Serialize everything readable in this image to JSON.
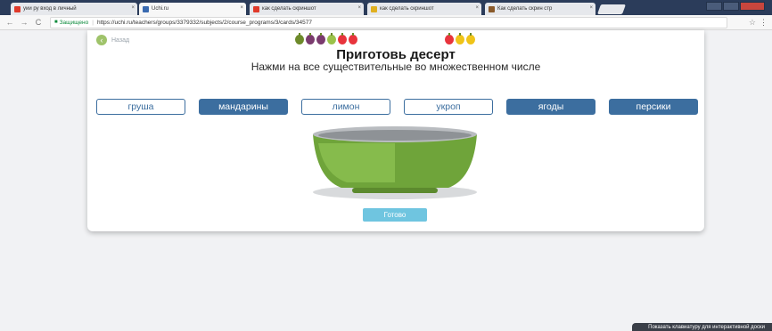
{
  "browser": {
    "tabs": [
      {
        "title": "уии ру вход в личный",
        "favicon_color": "#e03a2a"
      },
      {
        "title": "Uchi.ru",
        "favicon_color": "#3a6ab0"
      },
      {
        "title": "как сделать скриншот",
        "favicon_color": "#e03a2a"
      },
      {
        "title": "как сделать скриншот",
        "favicon_color": "#e0b020"
      },
      {
        "title": "Как сделать скрин стр",
        "favicon_color": "#8a5a2a"
      }
    ],
    "secure_label": "Защищено",
    "url": "https://uchi.ru/teachers/groups/3379332/subjects/2/course_programs/3/cards/34577"
  },
  "card": {
    "back_label": "Назад",
    "title": "Приготовь десерт",
    "subtitle": "Нажми на все существительные во множественном числе",
    "fruits_left": [
      "#6d8a2a",
      "#7a3b6e",
      "#7a3b6e",
      "#9bc24a",
      "#e8343c",
      "#e8343c"
    ],
    "fruits_right": [
      "#e8343c",
      "#f0c419",
      "#f0c419"
    ],
    "words": [
      {
        "text": "груша",
        "selected": false
      },
      {
        "text": "мандарины",
        "selected": true
      },
      {
        "text": "лимон",
        "selected": false
      },
      {
        "text": "укроп",
        "selected": false
      },
      {
        "text": "ягоды",
        "selected": true
      },
      {
        "text": "персики",
        "selected": true
      }
    ],
    "done_label": "Готово"
  },
  "keyboard_hint": "Показать клавиатуру для интерактивной доски",
  "colors": {
    "accent": "#3c6e9f",
    "done": "#6fc5e0",
    "bowl": "#7db043"
  }
}
